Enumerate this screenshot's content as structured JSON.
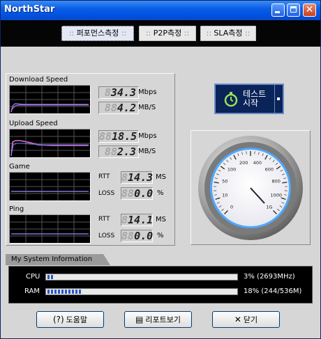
{
  "window": {
    "title": "NorthStar"
  },
  "tabs": [
    {
      "label": "퍼포먼스측정",
      "active": true
    },
    {
      "label": "P2P측정",
      "active": false
    },
    {
      "label": "SLA측정",
      "active": false
    }
  ],
  "download": {
    "label": "Download Speed",
    "mbps": {
      "ghost": "8",
      "value": "34.3",
      "unit": "Mbps"
    },
    "mbs": {
      "ghost": "88",
      "value": "4.2",
      "unit": "MB/S"
    }
  },
  "upload": {
    "label": "Upload Speed",
    "mbps": {
      "ghost": "88",
      "value": "18.5",
      "unit": "Mbps"
    },
    "mbs": {
      "ghost": "88",
      "value": "2.3",
      "unit": "MB/S"
    }
  },
  "game": {
    "label": "Game",
    "rtt": {
      "label": "RTT",
      "ghost": "8",
      "value": "14.3",
      "unit": "MS"
    },
    "loss": {
      "label": "LOSS",
      "ghost": "88",
      "value": "0.0",
      "unit": "%"
    }
  },
  "ping": {
    "label": "Ping",
    "rtt": {
      "label": "RTT",
      "ghost": "8",
      "value": "14.1",
      "unit": "MS"
    },
    "loss": {
      "label": "LOSS",
      "ghost": "88",
      "value": "0.0",
      "unit": "%"
    }
  },
  "start_button": {
    "label": "테스트 시작"
  },
  "gauge": {
    "ticks": [
      "0",
      "10",
      "50",
      "100",
      "200",
      "400",
      "600",
      "800",
      "1000",
      "1G"
    ],
    "needle_value": "1",
    "unit_top": "Mbit",
    "unit_bottom": "Mbit"
  },
  "sysinfo": {
    "header": "My System Information",
    "cpu": {
      "label": "CPU",
      "percent": 3,
      "value": "3% (2693MHz)"
    },
    "ram": {
      "label": "RAM",
      "percent": 18,
      "value": "18% (244/536M)"
    }
  },
  "buttons": {
    "help": "도움말",
    "report": "리포트보기",
    "close": "닫기"
  },
  "colors": {
    "titlebar": "#0054e3",
    "graph_bg": "#000000",
    "graph_trace_pink": "#e070d0",
    "graph_trace_blue": "#6a7ff0",
    "start_button_bg": "#0a2358"
  }
}
